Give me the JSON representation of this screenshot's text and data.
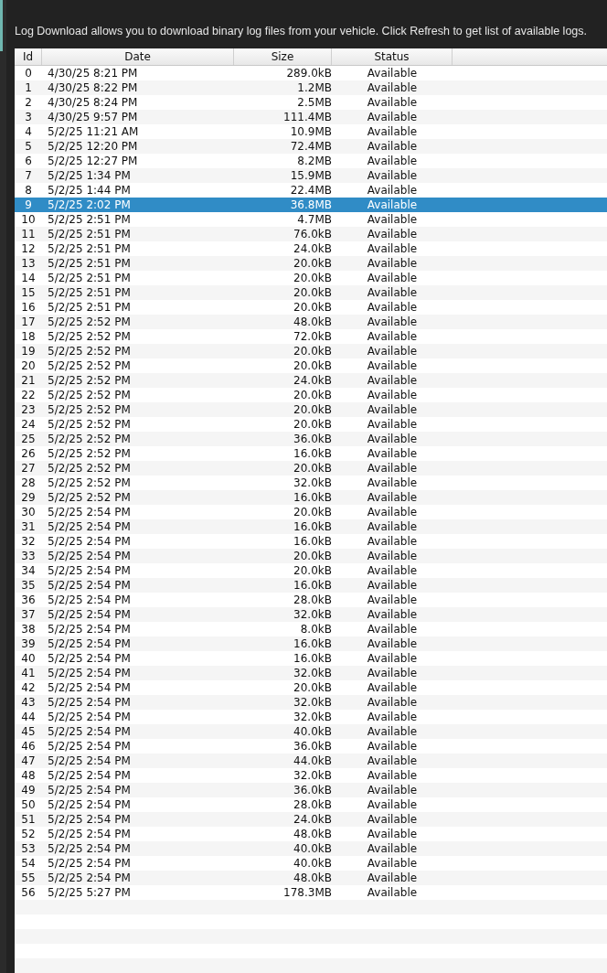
{
  "description": "Log Download allows you to download binary log files from your vehicle. Click Refresh to get list of available logs.",
  "table": {
    "columns": [
      "Id",
      "Date",
      "Size",
      "Status"
    ],
    "rows": [
      {
        "id": "0",
        "date": "4/30/25 8:21 PM",
        "size": "289.0kB",
        "status": "Available",
        "selected": false
      },
      {
        "id": "1",
        "date": "4/30/25 8:22 PM",
        "size": "1.2MB",
        "status": "Available",
        "selected": false
      },
      {
        "id": "2",
        "date": "4/30/25 8:24 PM",
        "size": "2.5MB",
        "status": "Available",
        "selected": false
      },
      {
        "id": "3",
        "date": "4/30/25 9:57 PM",
        "size": "111.4MB",
        "status": "Available",
        "selected": false
      },
      {
        "id": "4",
        "date": "5/2/25 11:21 AM",
        "size": "10.9MB",
        "status": "Available",
        "selected": false
      },
      {
        "id": "5",
        "date": "5/2/25 12:20 PM",
        "size": "72.4MB",
        "status": "Available",
        "selected": false
      },
      {
        "id": "6",
        "date": "5/2/25 12:27 PM",
        "size": "8.2MB",
        "status": "Available",
        "selected": false
      },
      {
        "id": "7",
        "date": "5/2/25 1:34 PM",
        "size": "15.9MB",
        "status": "Available",
        "selected": false
      },
      {
        "id": "8",
        "date": "5/2/25 1:44 PM",
        "size": "22.4MB",
        "status": "Available",
        "selected": false
      },
      {
        "id": "9",
        "date": "5/2/25 2:02 PM",
        "size": "36.8MB",
        "status": "Available",
        "selected": true
      },
      {
        "id": "10",
        "date": "5/2/25 2:51 PM",
        "size": "4.7MB",
        "status": "Available",
        "selected": false
      },
      {
        "id": "11",
        "date": "5/2/25 2:51 PM",
        "size": "76.0kB",
        "status": "Available",
        "selected": false
      },
      {
        "id": "12",
        "date": "5/2/25 2:51 PM",
        "size": "24.0kB",
        "status": "Available",
        "selected": false
      },
      {
        "id": "13",
        "date": "5/2/25 2:51 PM",
        "size": "20.0kB",
        "status": "Available",
        "selected": false
      },
      {
        "id": "14",
        "date": "5/2/25 2:51 PM",
        "size": "20.0kB",
        "status": "Available",
        "selected": false
      },
      {
        "id": "15",
        "date": "5/2/25 2:51 PM",
        "size": "20.0kB",
        "status": "Available",
        "selected": false
      },
      {
        "id": "16",
        "date": "5/2/25 2:51 PM",
        "size": "20.0kB",
        "status": "Available",
        "selected": false
      },
      {
        "id": "17",
        "date": "5/2/25 2:52 PM",
        "size": "48.0kB",
        "status": "Available",
        "selected": false
      },
      {
        "id": "18",
        "date": "5/2/25 2:52 PM",
        "size": "72.0kB",
        "status": "Available",
        "selected": false
      },
      {
        "id": "19",
        "date": "5/2/25 2:52 PM",
        "size": "20.0kB",
        "status": "Available",
        "selected": false
      },
      {
        "id": "20",
        "date": "5/2/25 2:52 PM",
        "size": "20.0kB",
        "status": "Available",
        "selected": false
      },
      {
        "id": "21",
        "date": "5/2/25 2:52 PM",
        "size": "24.0kB",
        "status": "Available",
        "selected": false
      },
      {
        "id": "22",
        "date": "5/2/25 2:52 PM",
        "size": "20.0kB",
        "status": "Available",
        "selected": false
      },
      {
        "id": "23",
        "date": "5/2/25 2:52 PM",
        "size": "20.0kB",
        "status": "Available",
        "selected": false
      },
      {
        "id": "24",
        "date": "5/2/25 2:52 PM",
        "size": "20.0kB",
        "status": "Available",
        "selected": false
      },
      {
        "id": "25",
        "date": "5/2/25 2:52 PM",
        "size": "36.0kB",
        "status": "Available",
        "selected": false
      },
      {
        "id": "26",
        "date": "5/2/25 2:52 PM",
        "size": "16.0kB",
        "status": "Available",
        "selected": false
      },
      {
        "id": "27",
        "date": "5/2/25 2:52 PM",
        "size": "20.0kB",
        "status": "Available",
        "selected": false
      },
      {
        "id": "28",
        "date": "5/2/25 2:52 PM",
        "size": "32.0kB",
        "status": "Available",
        "selected": false
      },
      {
        "id": "29",
        "date": "5/2/25 2:52 PM",
        "size": "16.0kB",
        "status": "Available",
        "selected": false
      },
      {
        "id": "30",
        "date": "5/2/25 2:54 PM",
        "size": "20.0kB",
        "status": "Available",
        "selected": false
      },
      {
        "id": "31",
        "date": "5/2/25 2:54 PM",
        "size": "16.0kB",
        "status": "Available",
        "selected": false
      },
      {
        "id": "32",
        "date": "5/2/25 2:54 PM",
        "size": "16.0kB",
        "status": "Available",
        "selected": false
      },
      {
        "id": "33",
        "date": "5/2/25 2:54 PM",
        "size": "20.0kB",
        "status": "Available",
        "selected": false
      },
      {
        "id": "34",
        "date": "5/2/25 2:54 PM",
        "size": "20.0kB",
        "status": "Available",
        "selected": false
      },
      {
        "id": "35",
        "date": "5/2/25 2:54 PM",
        "size": "16.0kB",
        "status": "Available",
        "selected": false
      },
      {
        "id": "36",
        "date": "5/2/25 2:54 PM",
        "size": "28.0kB",
        "status": "Available",
        "selected": false
      },
      {
        "id": "37",
        "date": "5/2/25 2:54 PM",
        "size": "32.0kB",
        "status": "Available",
        "selected": false
      },
      {
        "id": "38",
        "date": "5/2/25 2:54 PM",
        "size": "8.0kB",
        "status": "Available",
        "selected": false
      },
      {
        "id": "39",
        "date": "5/2/25 2:54 PM",
        "size": "16.0kB",
        "status": "Available",
        "selected": false
      },
      {
        "id": "40",
        "date": "5/2/25 2:54 PM",
        "size": "16.0kB",
        "status": "Available",
        "selected": false
      },
      {
        "id": "41",
        "date": "5/2/25 2:54 PM",
        "size": "32.0kB",
        "status": "Available",
        "selected": false
      },
      {
        "id": "42",
        "date": "5/2/25 2:54 PM",
        "size": "20.0kB",
        "status": "Available",
        "selected": false
      },
      {
        "id": "43",
        "date": "5/2/25 2:54 PM",
        "size": "32.0kB",
        "status": "Available",
        "selected": false
      },
      {
        "id": "44",
        "date": "5/2/25 2:54 PM",
        "size": "32.0kB",
        "status": "Available",
        "selected": false
      },
      {
        "id": "45",
        "date": "5/2/25 2:54 PM",
        "size": "40.0kB",
        "status": "Available",
        "selected": false
      },
      {
        "id": "46",
        "date": "5/2/25 2:54 PM",
        "size": "36.0kB",
        "status": "Available",
        "selected": false
      },
      {
        "id": "47",
        "date": "5/2/25 2:54 PM",
        "size": "44.0kB",
        "status": "Available",
        "selected": false
      },
      {
        "id": "48",
        "date": "5/2/25 2:54 PM",
        "size": "32.0kB",
        "status": "Available",
        "selected": false
      },
      {
        "id": "49",
        "date": "5/2/25 2:54 PM",
        "size": "36.0kB",
        "status": "Available",
        "selected": false
      },
      {
        "id": "50",
        "date": "5/2/25 2:54 PM",
        "size": "28.0kB",
        "status": "Available",
        "selected": false
      },
      {
        "id": "51",
        "date": "5/2/25 2:54 PM",
        "size": "24.0kB",
        "status": "Available",
        "selected": false
      },
      {
        "id": "52",
        "date": "5/2/25 2:54 PM",
        "size": "48.0kB",
        "status": "Available",
        "selected": false
      },
      {
        "id": "53",
        "date": "5/2/25 2:54 PM",
        "size": "40.0kB",
        "status": "Available",
        "selected": false
      },
      {
        "id": "54",
        "date": "5/2/25 2:54 PM",
        "size": "40.0kB",
        "status": "Available",
        "selected": false
      },
      {
        "id": "55",
        "date": "5/2/25 2:54 PM",
        "size": "48.0kB",
        "status": "Available",
        "selected": false
      },
      {
        "id": "56",
        "date": "5/2/25 5:27 PM",
        "size": "178.3MB",
        "status": "Available",
        "selected": false
      }
    ]
  }
}
